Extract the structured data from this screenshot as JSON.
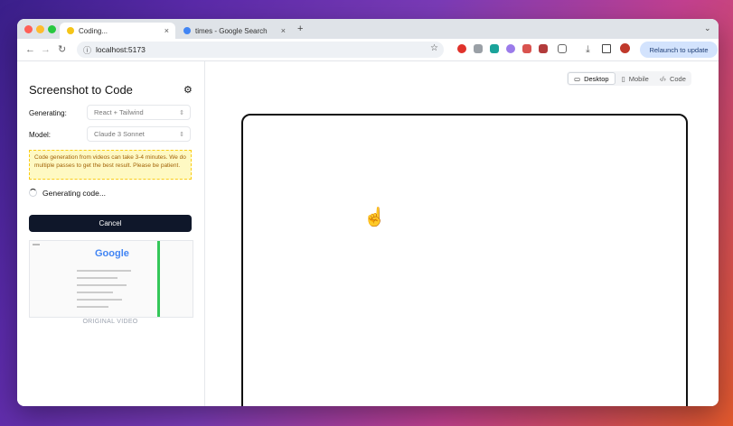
{
  "browser": {
    "tabs": [
      {
        "label": "Coding...",
        "favicon_color": "#f5c518",
        "active": true
      },
      {
        "label": "times - Google Search",
        "favicon_color": "#4285f4",
        "active": false
      }
    ],
    "new_tab_label": "+",
    "close_label": "×",
    "url": "localhost:5173",
    "relaunch_label": "Relaunch to update"
  },
  "sidebar": {
    "title": "Screenshot to Code",
    "generating_label": "Generating:",
    "generating_value": "React + Tailwind",
    "model_label": "Model:",
    "model_value": "Claude 3 Sonnet",
    "warning": "Code generation from videos can take 3-4 minutes. We do multiple passes to get the best result. Please be patient.",
    "status": "Generating code...",
    "cancel_label": "Cancel",
    "thumbnail_logo": "Google",
    "caption": "ORIGINAL VIDEO"
  },
  "view_tabs": [
    {
      "label": "Desktop",
      "icon": "monitor-icon",
      "active": true
    },
    {
      "label": "Mobile",
      "icon": "phone-icon",
      "active": false
    },
    {
      "label": "Code",
      "icon": "code-icon",
      "active": false
    }
  ],
  "colors": {
    "accent": "#0f172a",
    "warning_bg": "#fef9c3",
    "warning_text": "#a16207",
    "relaunch_bg": "#d3e3fd"
  }
}
